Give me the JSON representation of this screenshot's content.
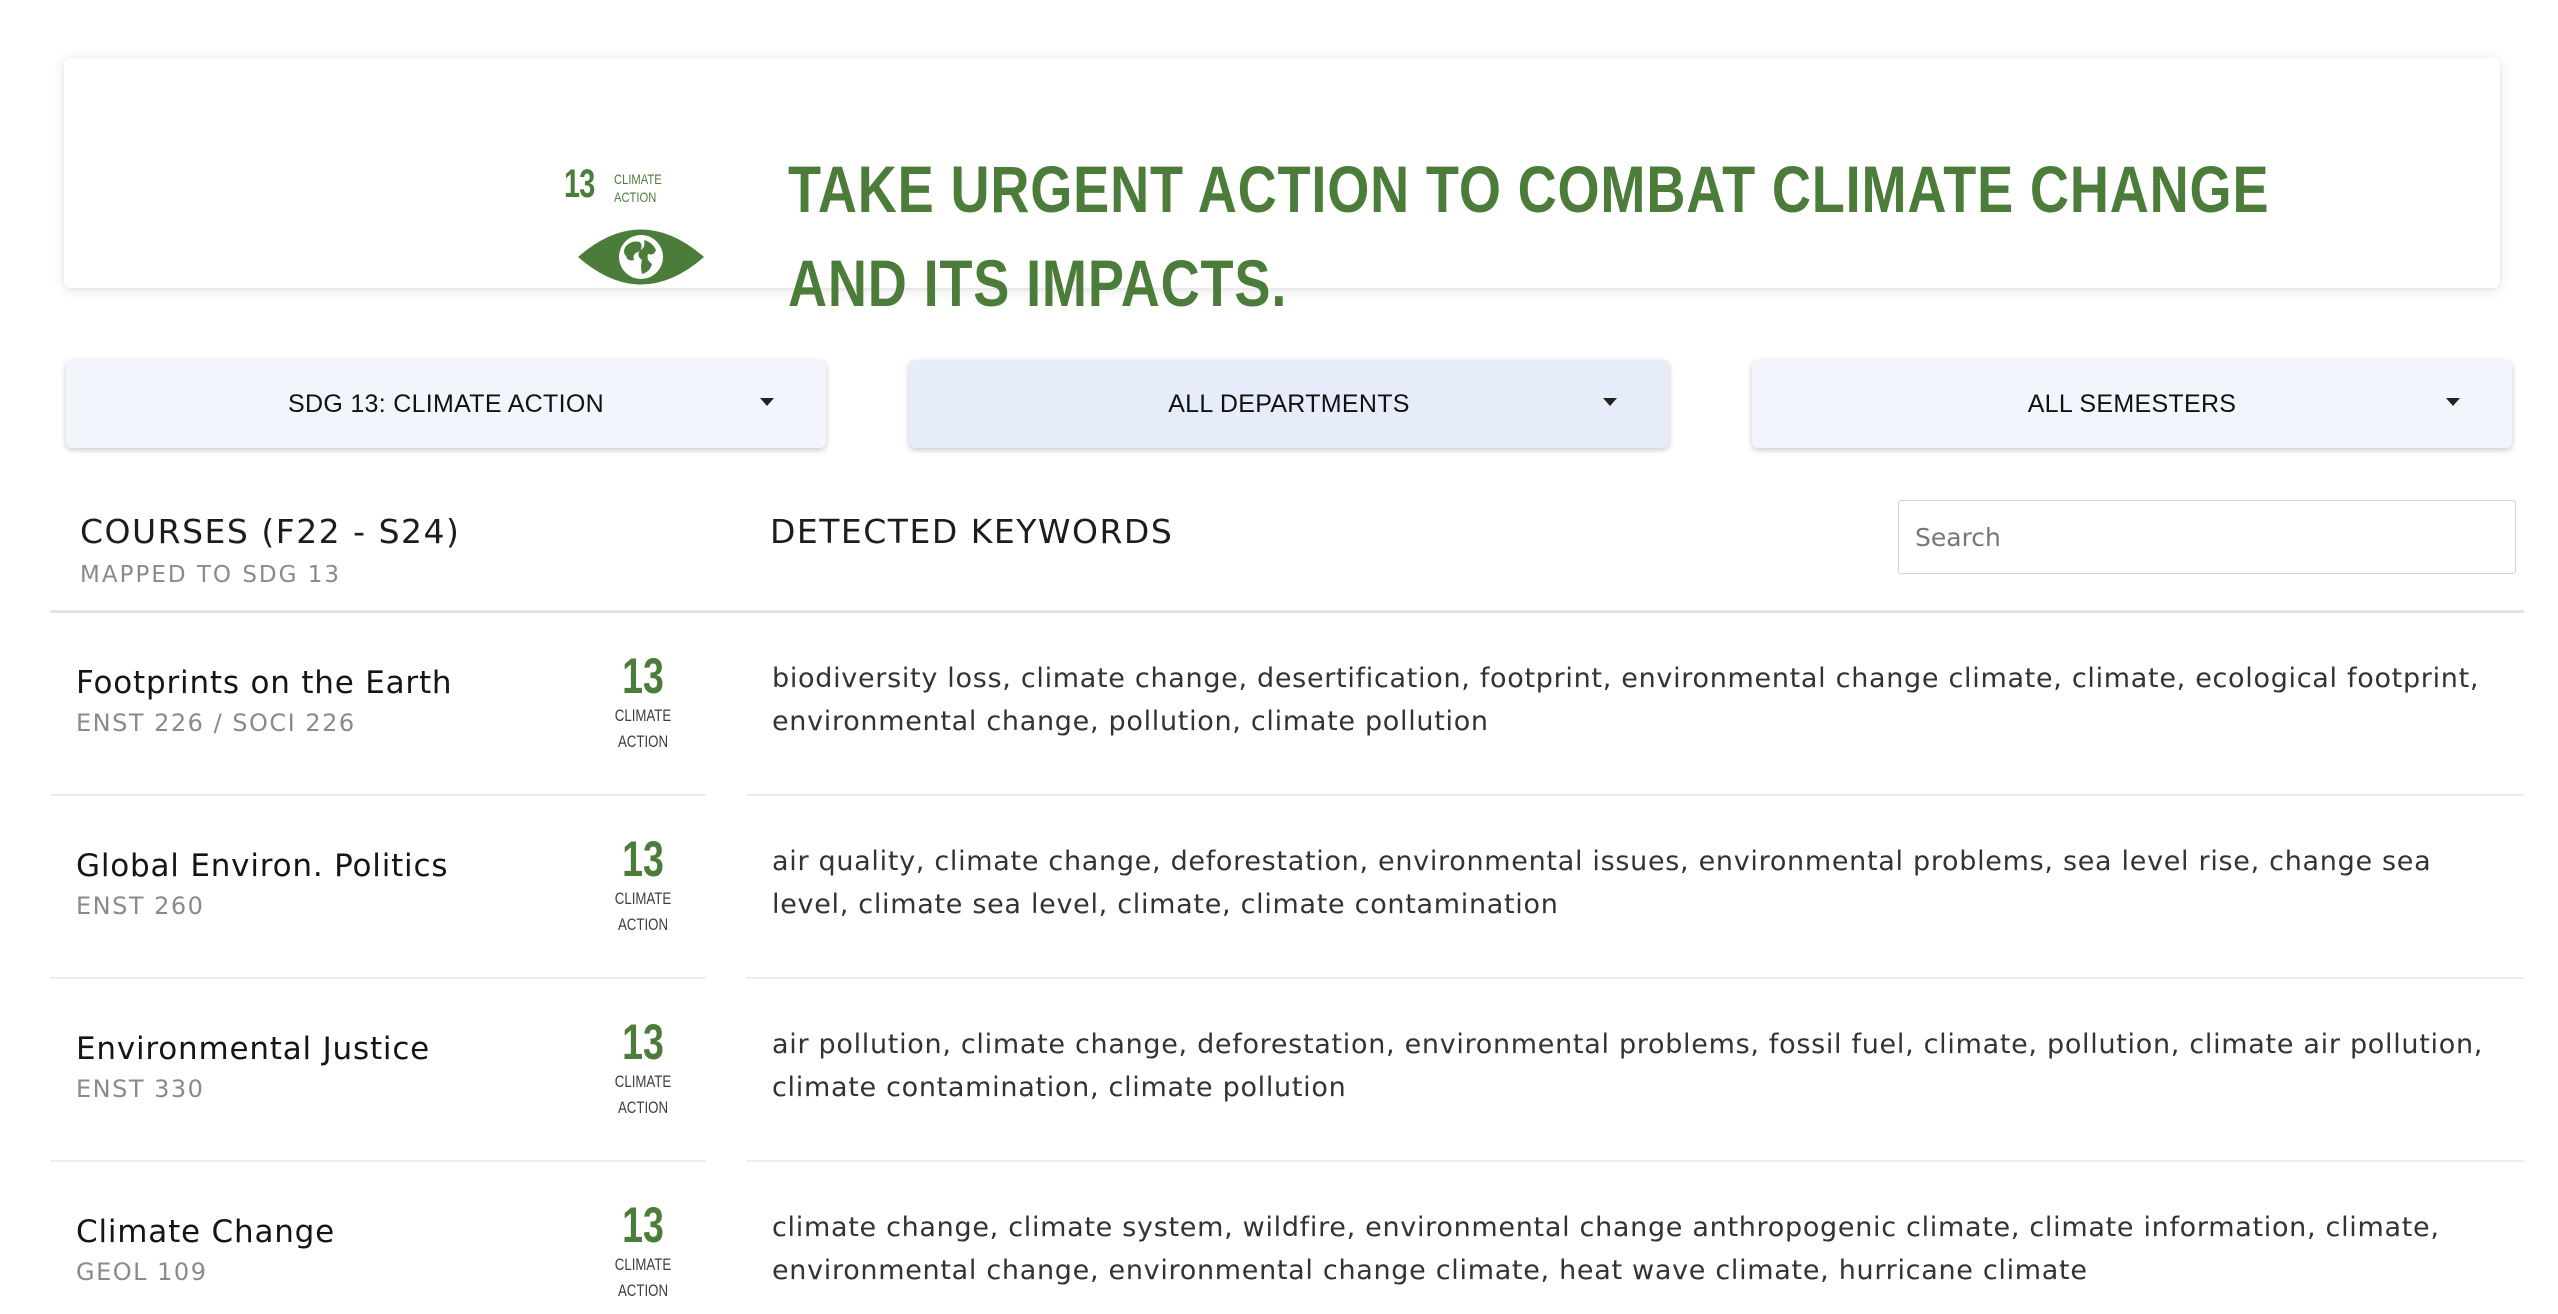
{
  "banner": {
    "sdg_number": "13",
    "sdg_label_line1": "CLIMATE",
    "sdg_label_line2": "ACTION",
    "title_line1": "TAKE URGENT ACTION TO COMBAT CLIMATE CHANGE",
    "title_line2": "AND ITS IMPACTS.",
    "brand_color": "#4c7c3a"
  },
  "filters": {
    "sdg": "SDG 13: CLIMATE ACTION",
    "department": "ALL DEPARTMENTS",
    "semester": "ALL SEMESTERS"
  },
  "table": {
    "courses_title": "COURSES (F22 - S24)",
    "courses_subtitle": "MAPPED TO SDG 13",
    "keywords_title": "DETECTED KEYWORDS",
    "search_placeholder": "Search",
    "badge_number": "13",
    "badge_line1": "CLIMATE",
    "badge_line2": "ACTION",
    "rows": [
      {
        "name": "Footprints on the Earth",
        "code": "ENST 226 / SOCI 226",
        "keywords": "biodiversity loss, climate change, desertification, footprint, environmental change climate, climate, ecological footprint, environmental change, pollution, climate pollution"
      },
      {
        "name": "Global Environ. Politics",
        "code": "ENST 260",
        "keywords": "air quality, climate change, deforestation, environmental issues, environmental problems, sea level rise, change sea level, climate sea level, climate, climate contamination"
      },
      {
        "name": "Environmental Justice",
        "code": "ENST 330",
        "keywords": "air pollution, climate change, deforestation, environmental problems, fossil fuel, climate, pollution, climate air pollution, climate contamination, climate pollution"
      },
      {
        "name": "Climate Change",
        "code": "GEOL 109",
        "keywords": "climate change, climate system, wildfire, environmental change anthropogenic climate, climate information, climate, environmental change, environmental change climate, heat wave climate, hurricane climate"
      }
    ]
  }
}
